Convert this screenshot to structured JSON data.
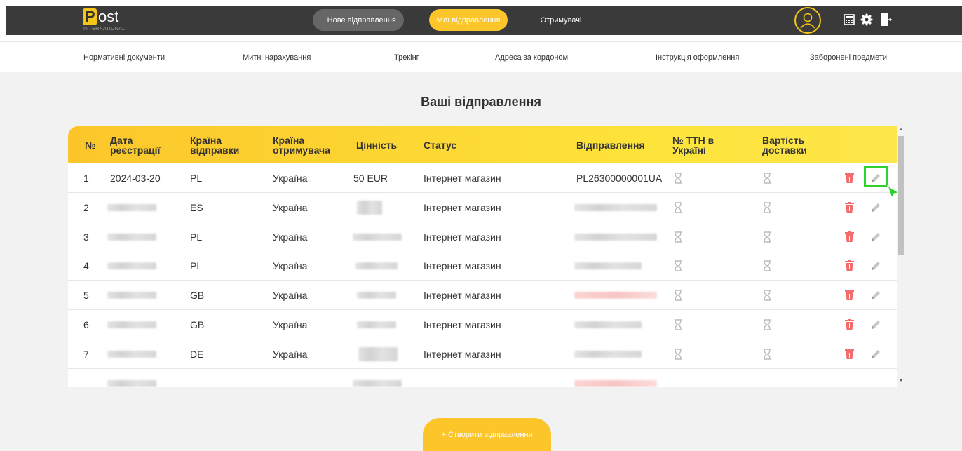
{
  "logo": {
    "mark": "P",
    "text": "ost",
    "sub": "INTERNATIONAL"
  },
  "nav": {
    "new_shipment": "+ Нове відправлення",
    "my_shipments": "Мої відправлення",
    "recipients": "Отримувачі"
  },
  "icons": {
    "avatar": "user-avatar-icon",
    "calculator": "calculator-icon",
    "settings": "gear-icon",
    "logout": "logout-icon"
  },
  "subnav": [
    "Нормативні документи",
    "Митні нарахування",
    "Трекінг",
    "Адреса за кордоном",
    "Інструкція оформлення",
    "Заборонені предмети"
  ],
  "page_title": "Ваші відправлення",
  "table": {
    "headers": {
      "num": "№",
      "date": [
        "Дата",
        "реєстрації"
      ],
      "from": [
        "Країна",
        "відправки"
      ],
      "to": [
        "Країна",
        "отримувача"
      ],
      "value": "Цінність",
      "status": "Статус",
      "shipment": "Відправлення",
      "ttn": [
        "№ ТТН в",
        "Україні"
      ],
      "cost": [
        "Вартість",
        "доставки"
      ]
    },
    "rows": [
      {
        "num": "1",
        "date": "2024-03-20",
        "from": "PL",
        "to": "Україна",
        "value": "50 EUR",
        "status": "Інтернет магазин",
        "shipment": "PL26300000001UA"
      },
      {
        "num": "2",
        "date": "",
        "from": "ES",
        "to": "Україна",
        "value": "",
        "status": "Інтернет магазин",
        "shipment": ""
      },
      {
        "num": "3",
        "date": "",
        "from": "PL",
        "to": "Україна",
        "value": "",
        "status": "Інтернет магазин",
        "shipment": ""
      },
      {
        "num": "4",
        "date": "",
        "from": "PL",
        "to": "Україна",
        "value": "",
        "status": "Інтернет магазин",
        "shipment": ""
      },
      {
        "num": "5",
        "date": "",
        "from": "GB",
        "to": "Україна",
        "value": "",
        "status": "Інтернет магазин",
        "shipment": ""
      },
      {
        "num": "6",
        "date": "",
        "from": "GB",
        "to": "Україна",
        "value": "",
        "status": "Інтернет магазин",
        "shipment": ""
      },
      {
        "num": "7",
        "date": "",
        "from": "DE",
        "to": "Україна",
        "value": "",
        "status": "Інтернет магазин",
        "shipment": ""
      }
    ]
  },
  "create_button": "+ Створити відправлення",
  "colors": {
    "accent": "#fcc62a",
    "dark": "#3a3a3a",
    "delete": "#f36b6b",
    "highlight": "#2ed12e"
  }
}
